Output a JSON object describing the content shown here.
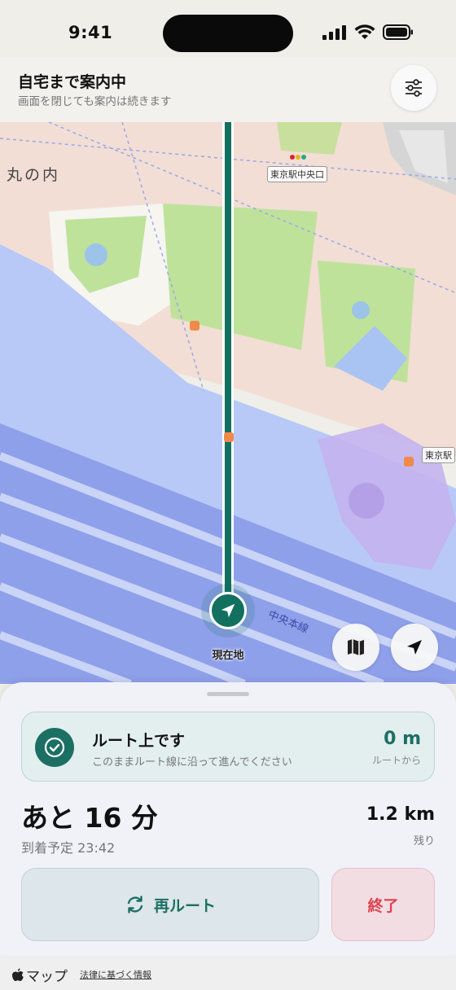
{
  "status_bar": {
    "time": "9:41"
  },
  "nav": {
    "title": "自宅まで案内中",
    "subtitle": "画面を閉じても案内は続きます"
  },
  "map": {
    "area_label": "丸の内",
    "station_label_1": "東京駅中央口",
    "station_label_2": "東京駅",
    "line_label": "中央本線",
    "current_location_label": "現在地",
    "route_color": "#12705f"
  },
  "route_status": {
    "title": "ルート上です",
    "subtitle": "このままルート線に沿って進んでください",
    "distance_value": "0 m",
    "distance_label": "ルートから"
  },
  "trip": {
    "eta": "あと 16 分",
    "arrival": "到着予定 23:42",
    "remaining_value": "1.2 km",
    "remaining_label": "残り"
  },
  "actions": {
    "reroute_label": "再ルート",
    "end_label": "終了"
  },
  "footer": {
    "brand": "マップ",
    "legal": "法律に基づく情報"
  },
  "colors": {
    "accent": "#1c6f63",
    "danger": "#e0414f"
  }
}
